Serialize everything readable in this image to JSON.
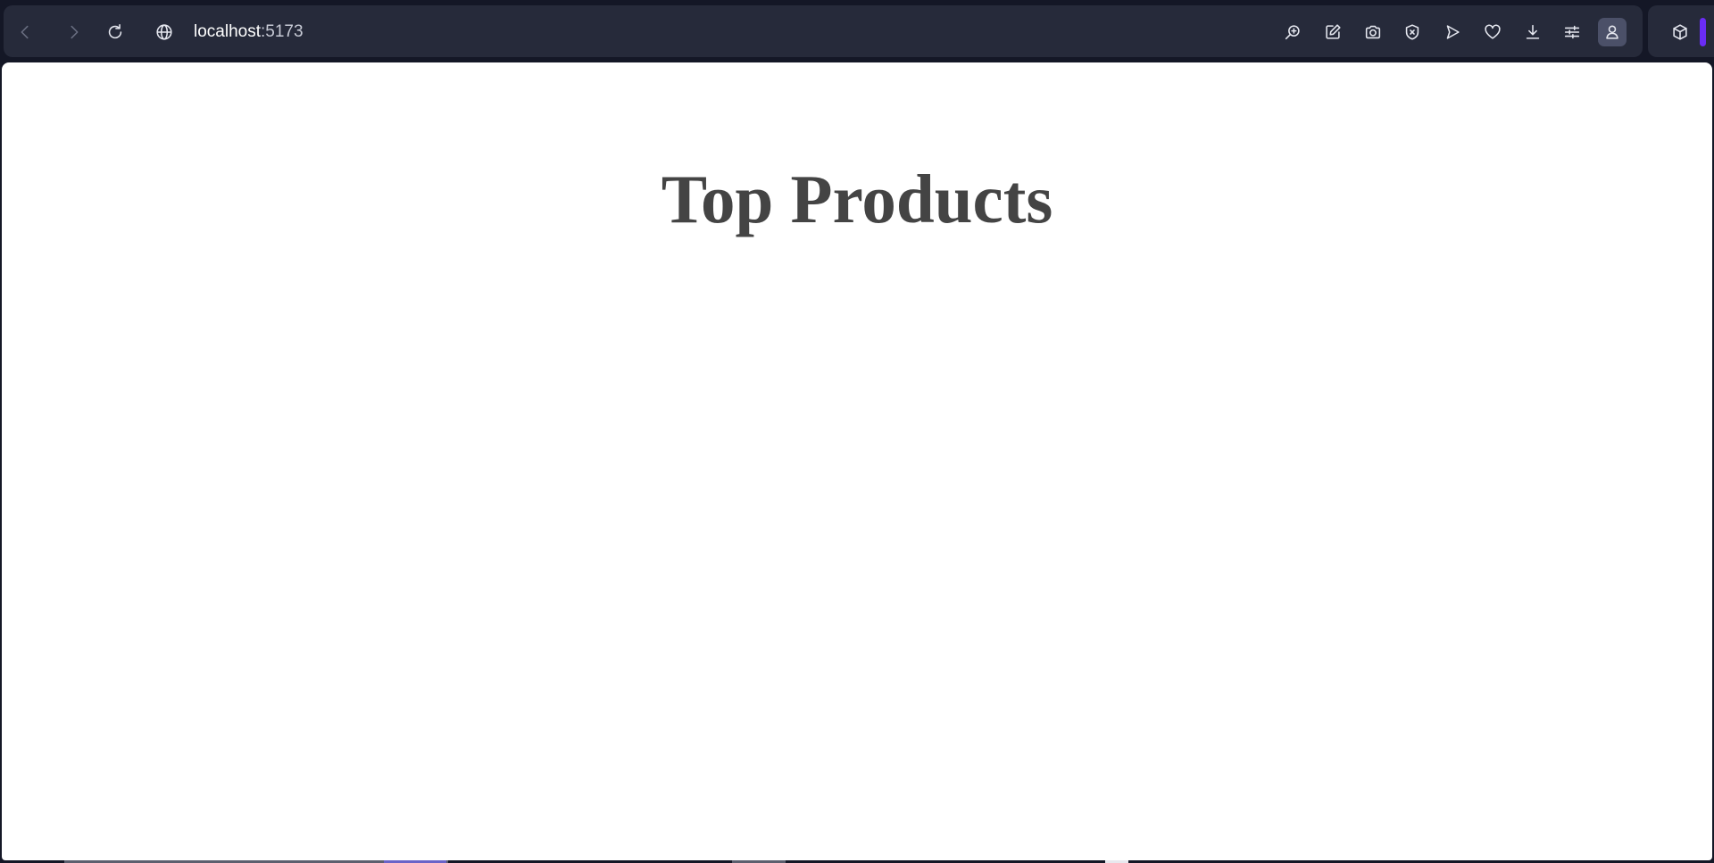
{
  "browser": {
    "address": {
      "host": "localhost",
      "port": ":5173"
    },
    "nav": {
      "back_icon": "chevron-left-icon",
      "forward_icon": "chevron-right-icon",
      "reload_icon": "reload-icon",
      "site_icon": "globe-icon"
    },
    "toolbar_icons": [
      "zoom-in-icon",
      "edit-page-icon",
      "camera-icon",
      "close-circle-icon",
      "send-icon",
      "heart-icon",
      "download-icon",
      "sliders-icon",
      "profile-icon",
      "cube-icon"
    ],
    "accent_color": "#6a2cf5"
  },
  "page": {
    "title": "Top Products"
  }
}
